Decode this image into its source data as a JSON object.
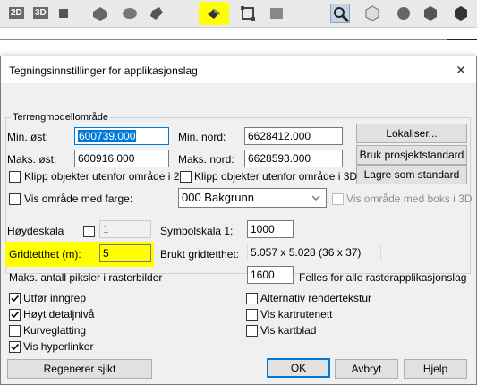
{
  "toolbar": {
    "buttons": [
      {
        "name": "2d-view-icon",
        "text": "2D"
      },
      {
        "name": "3d-view-icon",
        "text": "3D"
      },
      {
        "name": "select-tool-icon"
      },
      {
        "name": "surface-tool-icon"
      },
      {
        "name": "shade-tool-icon"
      },
      {
        "name": "solid-tool-icon"
      },
      {
        "name": "terrain-model-icon",
        "highlighted": true
      },
      {
        "name": "frame-tool-icon"
      },
      {
        "name": "grid-tool-icon"
      },
      {
        "name": "zoom-icon",
        "pressed": true
      },
      {
        "name": "cube-outline-icon"
      },
      {
        "name": "sphere-icon"
      },
      {
        "name": "hexagon-icon"
      },
      {
        "name": "cube-solid-icon"
      }
    ],
    "highlight_color": "#ffff00"
  },
  "dialog": {
    "title": "Tegningsinnstillinger for applikasjonslag",
    "close_symbol": "✕",
    "terrain": {
      "group_label": "Terrengmodellområde",
      "min_east_label": "Min. øst:",
      "min_east_value": "600739.000",
      "min_north_label": "Min. nord:",
      "min_north_value": "6628412.000",
      "max_east_label": "Maks. øst:",
      "max_east_value": "600916.000",
      "max_north_label": "Maks. nord:",
      "max_north_value": "6628593.000",
      "locate_button": "Lokaliser...",
      "use_project_button": "Bruk prosjektstandard",
      "save_default_button": "Lagre som standard",
      "clip_2d_label": "Klipp objekter utenfor område i 2D",
      "clip_2d_checked": false,
      "clip_3d_label": "Klipp objekter utenfor område i 3D",
      "clip_3d_checked": false,
      "show_color_label": "Vis område med farge:",
      "show_color_checked": false,
      "color_value": "000 Bakgrunn",
      "show_box_label": "Vis område med boks i 3D",
      "show_box_checked": false
    },
    "height_scale_label": "Høydeskala",
    "height_scale_checked": false,
    "height_scale_value": "1",
    "symbol_scale_label": "Symbolskala 1:",
    "symbol_scale_value": "1000",
    "grid_density_label": "Gridtetthet (m):",
    "grid_density_value": "5",
    "used_density_label": "Brukt gridtetthet:",
    "used_density_value": "5.057 x 5.028 (36 x 37)",
    "max_pixels_label": "Maks. antall piksler i rasterbilder",
    "max_pixels_value": "1600",
    "max_pixels_note": "Felles for alle rasterapplikasjonslag",
    "options_left": [
      {
        "label": "Utfør inngrep",
        "checked": true
      },
      {
        "label": "Høyt detaljnivå",
        "checked": true
      },
      {
        "label": "Kurveglatting",
        "checked": false
      },
      {
        "label": "Vis hyperlinker",
        "checked": true
      }
    ],
    "options_right": [
      {
        "label": "Alternativ rendertekstur",
        "checked": false
      },
      {
        "label": "Vis kartrutenett",
        "checked": false
      },
      {
        "label": "Vis kartblad",
        "checked": false
      }
    ],
    "regenerate_button": "Regenerer sjikt",
    "ok_button": "OK",
    "cancel_button": "Avbryt",
    "help_button": "Hjelp"
  }
}
